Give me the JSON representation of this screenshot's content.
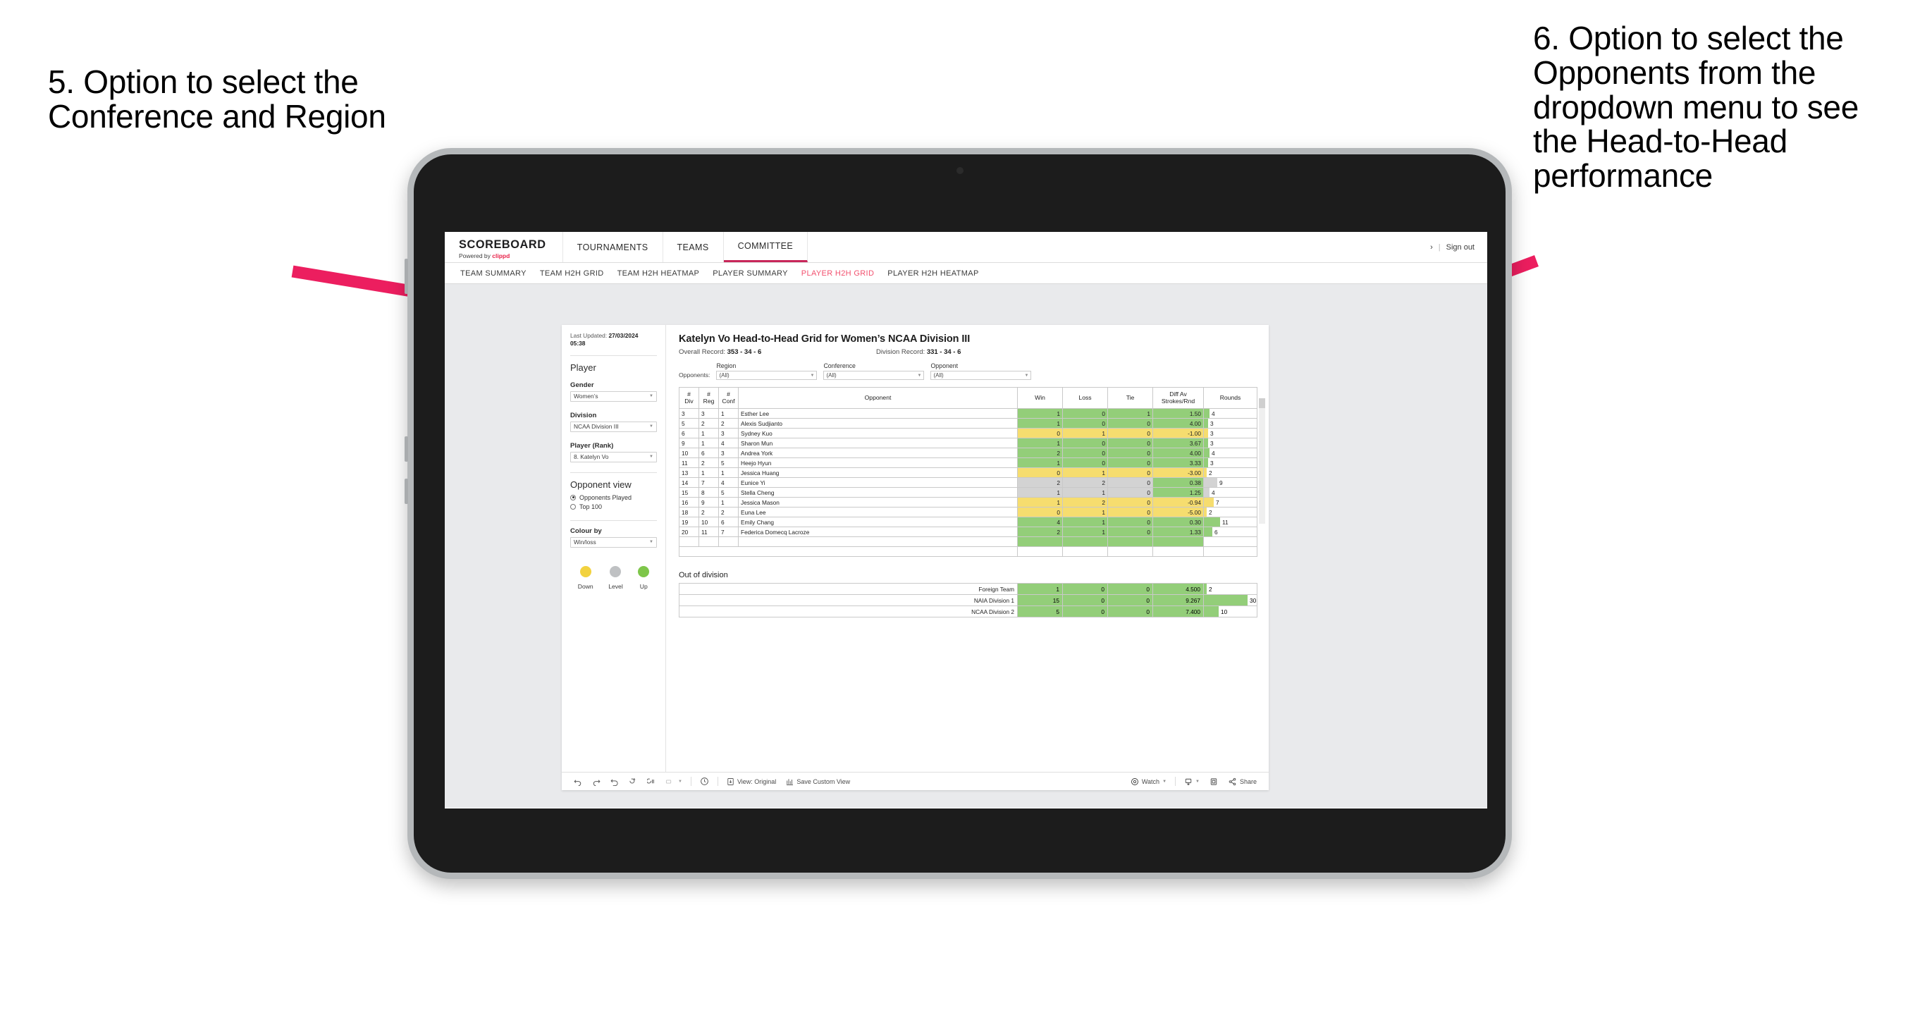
{
  "annotations": {
    "left": "5. Option to select the Conference and Region",
    "right": "6. Option to select the Opponents from the dropdown menu to see the Head-to-Head performance"
  },
  "topnav": {
    "brand_title": "SCOREBOARD",
    "brand_sub_prefix": "Powered by ",
    "brand_sub_brand": "clippd",
    "items": [
      {
        "label": "TOURNAMENTS",
        "active": false
      },
      {
        "label": "TEAMS",
        "active": false
      },
      {
        "label": "COMMITTEE",
        "active": true
      }
    ],
    "right_icon": "chevron-right-icon",
    "separator": "|",
    "signout_label": "Sign out"
  },
  "subnav": {
    "items": [
      {
        "label": "TEAM SUMMARY",
        "active": false
      },
      {
        "label": "TEAM H2H GRID",
        "active": false
      },
      {
        "label": "TEAM H2H HEATMAP",
        "active": false
      },
      {
        "label": "PLAYER SUMMARY",
        "active": false
      },
      {
        "label": "PLAYER H2H GRID",
        "active": true
      },
      {
        "label": "PLAYER H2H HEATMAP",
        "active": false
      }
    ]
  },
  "sidepanel": {
    "last_updated_label": "Last Updated: ",
    "last_updated_value": "27/03/2024",
    "last_updated_time": "05:38",
    "player_heading": "Player",
    "gender_label": "Gender",
    "gender_value": "Women’s",
    "division_label": "Division",
    "division_value": "NCAA Division III",
    "player_rank_label": "Player (Rank)",
    "player_rank_value": "8. Katelyn Vo",
    "opponent_view_heading": "Opponent view",
    "opponent_view_options": [
      {
        "label": "Opponents Played",
        "selected": true
      },
      {
        "label": "Top 100",
        "selected": false
      }
    ],
    "colour_by_label": "Colour by",
    "colour_by_value": "Win/loss",
    "legend": [
      {
        "label": "Down",
        "color": "#f2d23f"
      },
      {
        "label": "Level",
        "color": "#bfc1c3"
      },
      {
        "label": "Up",
        "color": "#7ec64a"
      }
    ]
  },
  "viz": {
    "title": "Katelyn Vo Head-to-Head Grid for Women’s NCAA Division III",
    "overall_record_label": "Overall Record: ",
    "overall_record_value": "353 - 34 - 6",
    "division_record_label": "Division Record: ",
    "division_record_value": "331 - 34 - 6",
    "opponents_label": "Opponents:",
    "filters": [
      {
        "name": "Region",
        "value": "(All)"
      },
      {
        "name": "Conference",
        "value": "(All)"
      },
      {
        "name": "Opponent",
        "value": "(All)"
      }
    ],
    "ood_title": "Out of division"
  },
  "chart_data": {
    "type": "table",
    "title": "Katelyn Vo Head-to-Head Grid for Women’s NCAA Division III",
    "columns": [
      "# Div",
      "# Reg",
      "# Conf",
      "Opponent",
      "Win",
      "Loss",
      "Tie",
      "Diff Av Strokes/Rnd",
      "Rounds"
    ],
    "column_headers_two_line": [
      [
        "#",
        "Div"
      ],
      [
        "#",
        "Reg"
      ],
      [
        "#",
        "Conf"
      ],
      [
        "",
        "Opponent"
      ],
      [
        "",
        "Win"
      ],
      [
        "",
        "Loss"
      ],
      [
        "",
        "Tie"
      ],
      [
        "Diff Av",
        "Strokes/Rnd"
      ],
      [
        "",
        "Rounds"
      ]
    ],
    "rows": [
      {
        "div": "3",
        "reg": "3",
        "conf": "1",
        "opponent": "Esther Lee",
        "win": "1",
        "loss": "0",
        "tie": "1",
        "diff": "1.50",
        "rounds": "4",
        "color": "#93ce79"
      },
      {
        "div": "5",
        "reg": "2",
        "conf": "2",
        "opponent": "Alexis Sudjianto",
        "win": "1",
        "loss": "0",
        "tie": "0",
        "diff": "4.00",
        "rounds": "3",
        "color": "#93ce79"
      },
      {
        "div": "6",
        "reg": "1",
        "conf": "3",
        "opponent": "Sydney Kuo",
        "win": "0",
        "loss": "1",
        "tie": "0",
        "diff": "-1.00",
        "rounds": "3",
        "color": "#f6dd6f"
      },
      {
        "div": "9",
        "reg": "1",
        "conf": "4",
        "opponent": "Sharon Mun",
        "win": "1",
        "loss": "0",
        "tie": "0",
        "diff": "3.67",
        "rounds": "3",
        "color": "#93ce79"
      },
      {
        "div": "10",
        "reg": "6",
        "conf": "3",
        "opponent": "Andrea York",
        "win": "2",
        "loss": "0",
        "tie": "0",
        "diff": "4.00",
        "rounds": "4",
        "color": "#93ce79"
      },
      {
        "div": "11",
        "reg": "2",
        "conf": "5",
        "opponent": "Heejo Hyun",
        "win": "1",
        "loss": "0",
        "tie": "0",
        "diff": "3.33",
        "rounds": "3",
        "color": "#93ce79"
      },
      {
        "div": "13",
        "reg": "1",
        "conf": "1",
        "opponent": "Jessica Huang",
        "win": "0",
        "loss": "1",
        "tie": "0",
        "diff": "-3.00",
        "rounds": "2",
        "color": "#f6dd6f"
      },
      {
        "div": "14",
        "reg": "7",
        "conf": "4",
        "opponent": "Eunice Yi",
        "win": "2",
        "loss": "2",
        "tie": "0",
        "diff": "0.38",
        "rounds": "9",
        "color": "#d3d3d3",
        "diff_color": "#93ce79"
      },
      {
        "div": "15",
        "reg": "8",
        "conf": "5",
        "opponent": "Stella Cheng",
        "win": "1",
        "loss": "1",
        "tie": "0",
        "diff": "1.25",
        "rounds": "4",
        "color": "#d3d3d3",
        "diff_color": "#93ce79"
      },
      {
        "div": "16",
        "reg": "9",
        "conf": "1",
        "opponent": "Jessica Mason",
        "win": "1",
        "loss": "2",
        "tie": "0",
        "diff": "-0.94",
        "rounds": "7",
        "color": "#f6dd6f"
      },
      {
        "div": "18",
        "reg": "2",
        "conf": "2",
        "opponent": "Euna Lee",
        "win": "0",
        "loss": "1",
        "tie": "0",
        "diff": "-5.00",
        "rounds": "2",
        "color": "#f6dd6f"
      },
      {
        "div": "19",
        "reg": "10",
        "conf": "6",
        "opponent": "Emily Chang",
        "win": "4",
        "loss": "1",
        "tie": "0",
        "diff": "0.30",
        "rounds": "11",
        "color": "#93ce79"
      },
      {
        "div": "20",
        "reg": "11",
        "conf": "7",
        "opponent": "Federica Domecq Lacroze",
        "win": "2",
        "loss": "1",
        "tie": "0",
        "diff": "1.33",
        "rounds": "6",
        "color": "#93ce79"
      }
    ],
    "out_of_division": {
      "title": "Out of division",
      "rows": [
        {
          "name": "Foreign Team",
          "win": "1",
          "loss": "0",
          "tie": "0",
          "diff": "4.500",
          "rounds": "2",
          "color": "#93ce79"
        },
        {
          "name": "NAIA Division 1",
          "win": "15",
          "loss": "0",
          "tie": "0",
          "diff": "9.267",
          "rounds": "30",
          "color": "#93ce79"
        },
        {
          "name": "NCAA Division 2",
          "win": "5",
          "loss": "0",
          "tie": "0",
          "diff": "7.400",
          "rounds": "10",
          "color": "#93ce79"
        }
      ]
    },
    "max_rounds": 30,
    "colors": {
      "up": "#93ce79",
      "down": "#f6dd6f",
      "level": "#d3d3d3",
      "accent": "#f2506e",
      "brand": "#e8234a"
    }
  },
  "toolbar": {
    "items": [
      {
        "icon": "undo-icon",
        "label": ""
      },
      {
        "icon": "redo-icon",
        "label": ""
      },
      {
        "icon": "revert-icon",
        "label": ""
      },
      {
        "icon": "refresh-icon",
        "label": ""
      },
      {
        "icon": "pause-icon",
        "label": ""
      },
      {
        "icon": "highlight-icon",
        "label": ""
      },
      {
        "icon": "clock-icon",
        "label": ""
      },
      {
        "icon": "view-icon",
        "label": "View: Original"
      },
      {
        "icon": "save-view-icon",
        "label": "Save Custom View"
      },
      {
        "icon": "watch-icon",
        "label": "Watch"
      },
      {
        "icon": "download-icon",
        "label": ""
      },
      {
        "icon": "fullscreen-icon",
        "label": ""
      },
      {
        "icon": "share-icon",
        "label": "Share"
      }
    ]
  }
}
